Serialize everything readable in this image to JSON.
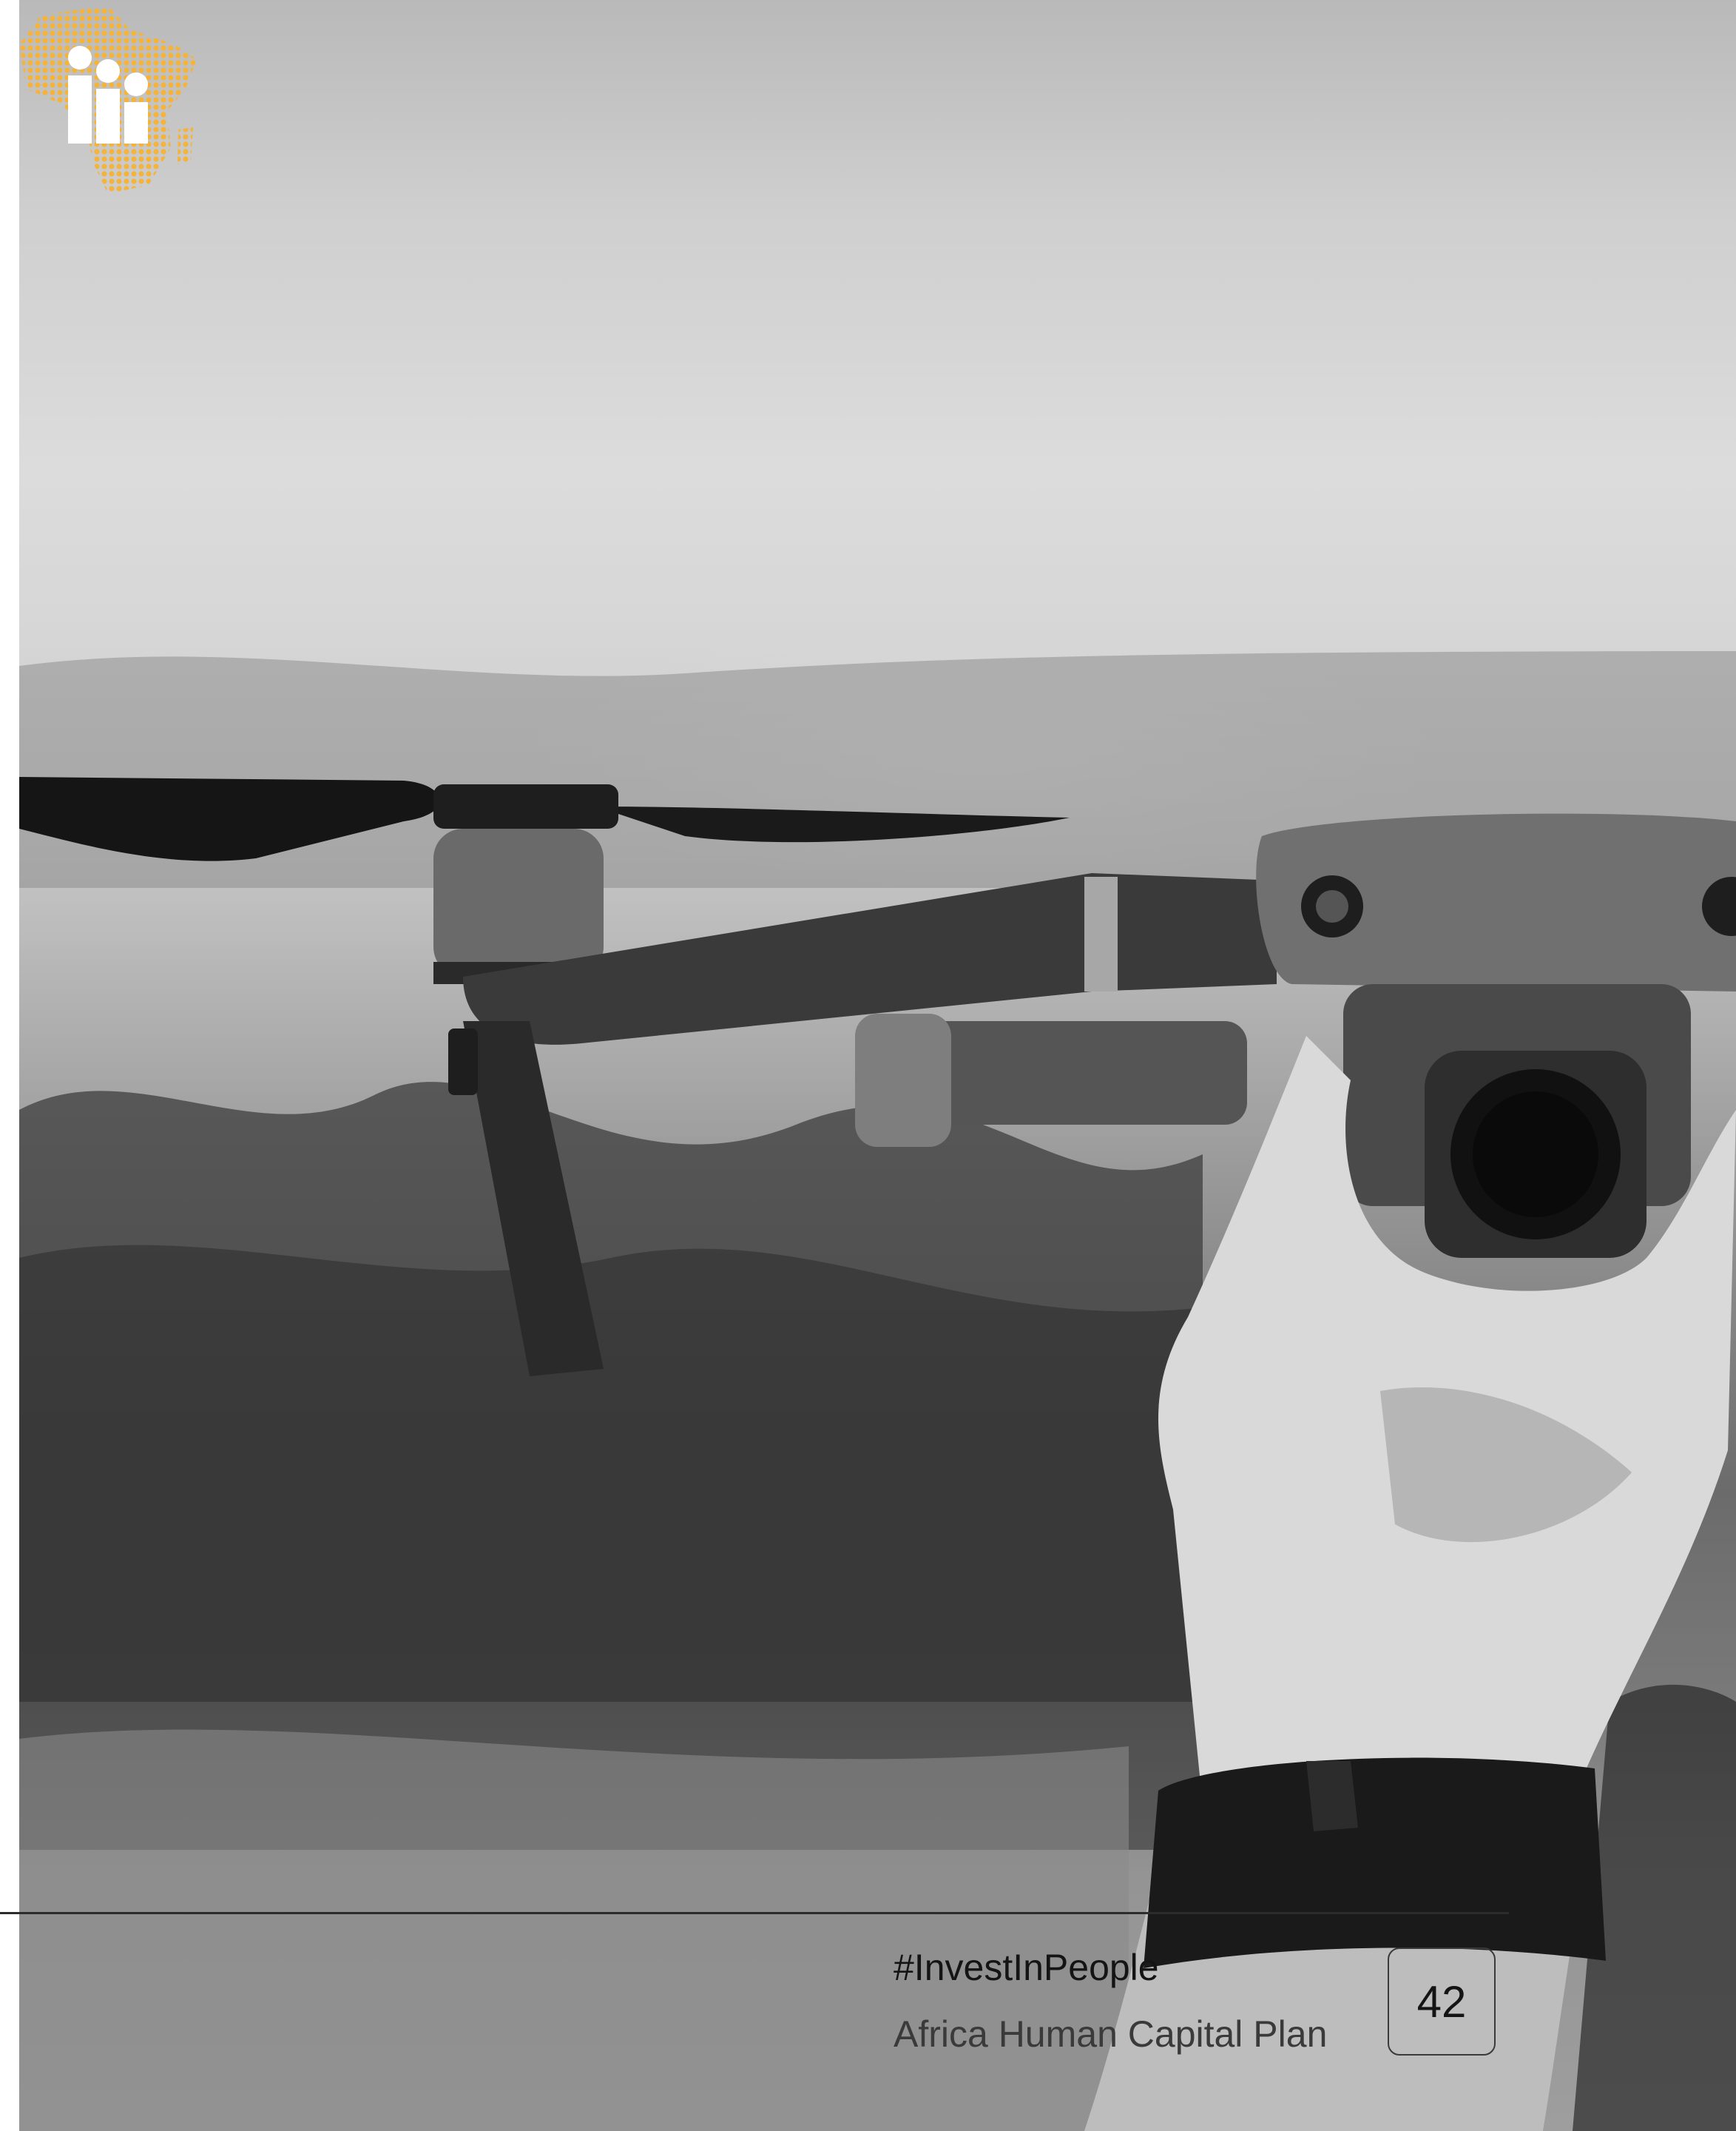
{
  "footer": {
    "hashtag": "#InvestInPeople",
    "subtitle": "Africa Human Capital Plan",
    "page_number": "42"
  },
  "colors": {
    "logo_gold": "#F4B33A",
    "rule": "#2C2C2C"
  },
  "icons": [
    "africa-human-capital-logo"
  ]
}
